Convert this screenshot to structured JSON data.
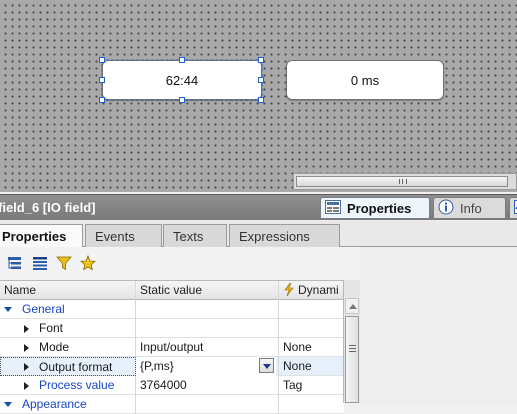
{
  "canvas": {
    "field_selected_value": "62:44",
    "field_second_value": "0 ms"
  },
  "inspector": {
    "title": "field_6 [IO field]",
    "tabs": {
      "properties": "Properties",
      "info": "Info"
    }
  },
  "subtabs": [
    "Properties",
    "Events",
    "Texts",
    "Expressions"
  ],
  "toolbar_icons": [
    "tree-view-icon",
    "list-view-icon",
    "filter-icon",
    "favorites-icon"
  ],
  "grid": {
    "headers": {
      "name": "Name",
      "static": "Static value",
      "dynamic": "Dynami"
    },
    "rows": [
      {
        "name": "General",
        "static": "",
        "dynamic": ""
      },
      {
        "name": "Font",
        "static": "",
        "dynamic": ""
      },
      {
        "name": "Mode",
        "static": "Input/output",
        "dynamic": "None"
      },
      {
        "name": "Output format",
        "static": "{P,ms}",
        "dynamic": "None"
      },
      {
        "name": "Process value",
        "static": "3764000",
        "dynamic": "Tag"
      },
      {
        "name": "Appearance",
        "static": "",
        "dynamic": ""
      }
    ]
  },
  "colors": {
    "accent": "#1846c5",
    "selection": "#1b63d3",
    "canvas": "#a9a9a9"
  }
}
